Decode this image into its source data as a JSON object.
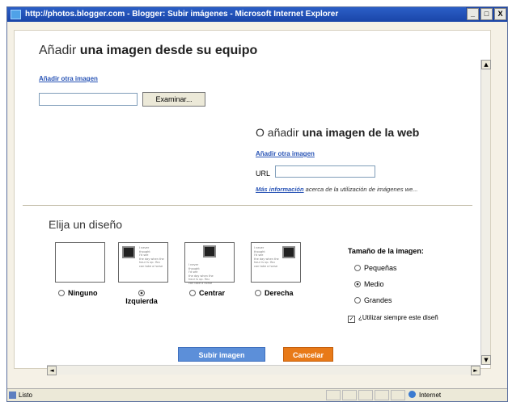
{
  "window": {
    "title": "http://photos.blogger.com - Blogger: Subir imágenes - Microsoft Internet Explorer",
    "buttons": [
      "_",
      "□",
      "X"
    ]
  },
  "local": {
    "heading_light": "Añadir ",
    "heading_bold": "una imagen desde su equipo",
    "add_another": "Añadir otra imagen",
    "file_value": "",
    "browse_label": "Examinar..."
  },
  "web": {
    "heading_light": "O añadir ",
    "heading_bold": "una imagen de la web",
    "add_another": "Añadir otra imagen",
    "url_label": "URL",
    "url_value": "",
    "more_info_link": "Más información",
    "more_info_text": " acerca de la utilización de imágenes we..."
  },
  "layout": {
    "heading": "Elija un diseño",
    "options": [
      {
        "label": "Ninguno",
        "selected": false
      },
      {
        "label": "Izquierda",
        "selected": true
      },
      {
        "label": "Centrar",
        "selected": false
      },
      {
        "label": "Derecha",
        "selected": false
      }
    ],
    "thumb_text": "I never\nthought\nI'd see\nthe day when the\nhour is up. You\ncan take a horse"
  },
  "size": {
    "title": "Tamaño de la imagen:",
    "options": [
      {
        "label": "Pequeñas",
        "selected": false
      },
      {
        "label": "Medio",
        "selected": true
      },
      {
        "label": "Grandes",
        "selected": false
      }
    ]
  },
  "always_use": {
    "label": "¿Utilizar siempre este diseñ",
    "checked": true
  },
  "actions": {
    "upload": "Subir imagen",
    "cancel": "Cancelar"
  },
  "statusbar": {
    "status": "Listo",
    "zone": "Internet"
  },
  "colors": {
    "titlebar": "#1a45a8",
    "upload": "#5c8fd9",
    "cancel": "#e87a18",
    "link": "#2a55b6"
  }
}
